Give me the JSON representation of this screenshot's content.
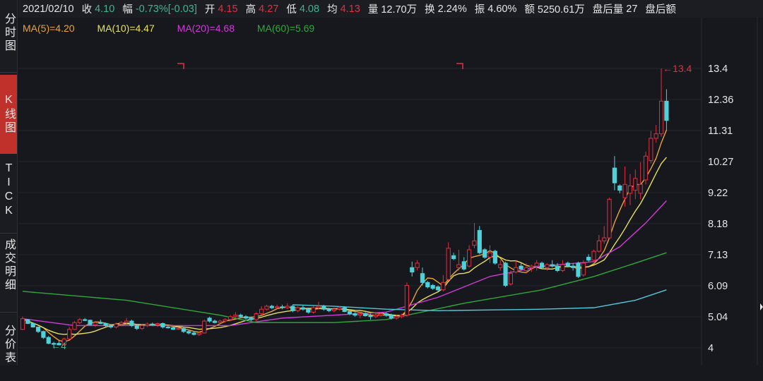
{
  "sidebar": {
    "items": [
      {
        "label": "分时图",
        "active": false
      },
      {
        "label": "K线图",
        "active": true
      },
      {
        "label": "TICK",
        "active": false
      },
      {
        "label": "成交明细",
        "active": false
      },
      {
        "label": "分价表",
        "active": false
      }
    ]
  },
  "header": {
    "date": "2021/02/10",
    "close_label": "收",
    "close": "4.10",
    "change_label": "幅",
    "change": "-0.73%[-0.03]",
    "open_label": "开",
    "open": "4.15",
    "high_label": "高",
    "high": "4.27",
    "low_label": "低",
    "low": "4.08",
    "avg_label": "均",
    "avg": "4.13",
    "volume_label": "量",
    "volume": "12.70万",
    "turnover_label": "换",
    "turnover": "2.24%",
    "amplitude_label": "振",
    "amplitude": "4.60%",
    "amount_label": "额",
    "amount": "5250.61万",
    "after_volume_label": "盘后量",
    "after_volume": "27",
    "after_amount_label": "盘后额"
  },
  "ma_legend": [
    {
      "label": "MA(5)=4.20",
      "color": "#e8a33a"
    },
    {
      "label": "MA(10)=4.47",
      "color": "#e6e05a"
    },
    {
      "label": "MA(20)=4.68",
      "color": "#d13ad6"
    },
    {
      "label": "MA(60)=5.69",
      "color": "#2fa83a"
    }
  ],
  "colors": {
    "up": "#e2303f",
    "down": "#4fd1d9",
    "background": "#16181d",
    "ma120": "#4fc8d9"
  },
  "chart_data": {
    "type": "candlestick",
    "ylim": [
      4,
      13.4
    ],
    "yticks": [
      "13.4",
      "12.36",
      "11.31",
      "10.27",
      "9.22",
      "8.18",
      "7.13",
      "6.09",
      "5.04",
      "4"
    ],
    "grid": true,
    "max_marker": "13.4",
    "min_marker": "4",
    "ohlc": [
      [
        4.62,
        5.05,
        4.6,
        4.98
      ],
      [
        4.95,
        4.97,
        4.8,
        4.82
      ],
      [
        4.82,
        4.85,
        4.68,
        4.7
      ],
      [
        4.7,
        4.72,
        4.5,
        4.55
      ],
      [
        4.55,
        4.58,
        4.3,
        4.35
      ],
      [
        4.35,
        4.4,
        4.12,
        4.15
      ],
      [
        4.15,
        4.2,
        4.0,
        4.12
      ],
      [
        4.15,
        4.27,
        4.08,
        4.1
      ],
      [
        4.1,
        4.35,
        4.1,
        4.3
      ],
      [
        4.3,
        4.7,
        4.28,
        4.62
      ],
      [
        4.62,
        4.9,
        4.6,
        4.85
      ],
      [
        4.85,
        5.0,
        4.8,
        4.95
      ],
      [
        4.95,
        5.0,
        4.9,
        4.93
      ],
      [
        4.93,
        4.95,
        4.75,
        4.78
      ],
      [
        4.78,
        4.9,
        4.7,
        4.85
      ],
      [
        4.85,
        4.95,
        4.8,
        4.82
      ],
      [
        4.82,
        4.85,
        4.7,
        4.75
      ],
      [
        4.75,
        4.8,
        4.65,
        4.7
      ],
      [
        4.7,
        4.85,
        4.65,
        4.8
      ],
      [
        4.8,
        4.9,
        4.75,
        4.85
      ],
      [
        4.85,
        5.0,
        4.8,
        4.9
      ],
      [
        4.9,
        4.95,
        4.7,
        4.75
      ],
      [
        4.75,
        4.8,
        4.6,
        4.65
      ],
      [
        4.65,
        4.8,
        4.6,
        4.75
      ],
      [
        4.75,
        4.85,
        4.7,
        4.8
      ],
      [
        4.8,
        4.85,
        4.75,
        4.78
      ],
      [
        4.78,
        4.85,
        4.7,
        4.82
      ],
      [
        4.82,
        4.85,
        4.65,
        4.7
      ],
      [
        4.7,
        4.75,
        4.65,
        4.68
      ],
      [
        4.68,
        4.72,
        4.6,
        4.62
      ],
      [
        4.62,
        4.7,
        4.6,
        4.65
      ],
      [
        4.65,
        4.68,
        4.5,
        4.55
      ],
      [
        4.55,
        4.6,
        4.45,
        4.5
      ],
      [
        4.5,
        4.55,
        4.42,
        4.45
      ],
      [
        4.45,
        4.55,
        4.4,
        4.5
      ],
      [
        4.5,
        4.95,
        4.48,
        4.9
      ],
      [
        5.0,
        5.05,
        4.85,
        4.9
      ],
      [
        4.9,
        4.95,
        4.82,
        4.85
      ],
      [
        4.85,
        4.95,
        4.8,
        4.9
      ],
      [
        4.9,
        5.0,
        4.85,
        4.95
      ],
      [
        4.95,
        5.1,
        4.9,
        5.05
      ],
      [
        5.05,
        5.2,
        5.0,
        5.1
      ],
      [
        5.1,
        5.15,
        5.0,
        5.05
      ],
      [
        5.05,
        5.1,
        4.95,
        5.0
      ],
      [
        5.0,
        5.05,
        4.9,
        4.95
      ],
      [
        4.95,
        5.2,
        4.9,
        5.15
      ],
      [
        5.15,
        5.4,
        5.1,
        5.3
      ],
      [
        5.3,
        5.45,
        5.25,
        5.4
      ],
      [
        5.4,
        5.45,
        5.3,
        5.35
      ],
      [
        5.35,
        5.45,
        5.3,
        5.38
      ],
      [
        5.38,
        5.45,
        5.3,
        5.35
      ],
      [
        5.35,
        5.5,
        5.3,
        5.4
      ],
      [
        5.4,
        5.45,
        5.2,
        5.25
      ],
      [
        5.25,
        5.4,
        5.2,
        5.35
      ],
      [
        5.35,
        5.45,
        5.25,
        5.3
      ],
      [
        5.3,
        5.35,
        5.15,
        5.2
      ],
      [
        5.2,
        5.4,
        5.15,
        5.35
      ],
      [
        5.35,
        5.55,
        5.3,
        5.4
      ],
      [
        5.4,
        5.45,
        5.25,
        5.3
      ],
      [
        5.3,
        5.35,
        5.2,
        5.25
      ],
      [
        5.25,
        5.35,
        5.2,
        5.3
      ],
      [
        5.3,
        5.4,
        5.25,
        5.35
      ],
      [
        5.35,
        5.4,
        5.2,
        5.22
      ],
      [
        5.22,
        5.3,
        5.1,
        5.15
      ],
      [
        5.15,
        5.2,
        5.05,
        5.1
      ],
      [
        5.1,
        5.2,
        5.0,
        5.15
      ],
      [
        5.15,
        5.2,
        5.05,
        5.08
      ],
      [
        5.08,
        5.15,
        4.95,
        5.05
      ],
      [
        5.05,
        5.15,
        5.0,
        5.1
      ],
      [
        5.1,
        5.2,
        5.05,
        5.15
      ],
      [
        5.15,
        5.2,
        5.05,
        5.1
      ],
      [
        5.1,
        5.15,
        4.95,
        5.0
      ],
      [
        5.0,
        5.1,
        4.95,
        5.05
      ],
      [
        5.05,
        5.15,
        5.0,
        5.1
      ],
      [
        5.1,
        6.2,
        5.05,
        6.1
      ],
      [
        6.7,
        6.9,
        6.4,
        6.55
      ],
      [
        6.7,
        6.95,
        6.6,
        6.85
      ],
      [
        6.5,
        6.7,
        6.1,
        6.2
      ],
      [
        6.2,
        6.25,
        6.0,
        6.05
      ],
      [
        6.1,
        6.15,
        5.95,
        6.0
      ],
      [
        6.05,
        6.1,
        5.9,
        5.95
      ],
      [
        5.95,
        6.45,
        5.9,
        6.2
      ],
      [
        6.3,
        7.55,
        6.25,
        7.35
      ],
      [
        7.1,
        7.2,
        6.95,
        7.0
      ],
      [
        6.7,
        7.3,
        6.6,
        6.8
      ],
      [
        6.9,
        7.05,
        6.6,
        6.65
      ],
      [
        6.75,
        7.45,
        6.7,
        7.3
      ],
      [
        7.45,
        8.2,
        7.35,
        7.6
      ],
      [
        7.95,
        8.1,
        7.15,
        7.2
      ],
      [
        7.3,
        7.35,
        7.0,
        7.05
      ],
      [
        7.05,
        7.45,
        6.85,
        7.2
      ],
      [
        7.25,
        7.3,
        6.8,
        6.85
      ],
      [
        6.7,
        6.95,
        6.6,
        6.8
      ],
      [
        6.85,
        6.9,
        6.05,
        6.1
      ],
      [
        6.15,
        6.6,
        6.1,
        6.5
      ],
      [
        6.55,
        6.95,
        6.5,
        6.7
      ],
      [
        6.75,
        6.85,
        6.6,
        6.65
      ],
      [
        6.6,
        6.85,
        6.5,
        6.7
      ],
      [
        6.7,
        6.8,
        6.55,
        6.75
      ],
      [
        6.75,
        6.95,
        6.6,
        6.85
      ],
      [
        6.85,
        6.9,
        6.65,
        6.7
      ],
      [
        6.7,
        6.85,
        6.6,
        6.8
      ],
      [
        6.8,
        6.95,
        6.7,
        6.75
      ],
      [
        6.75,
        6.85,
        6.55,
        6.6
      ],
      [
        6.6,
        6.95,
        6.55,
        6.8
      ],
      [
        6.85,
        6.9,
        6.7,
        6.75
      ],
      [
        6.75,
        6.85,
        6.6,
        6.7
      ],
      [
        6.85,
        6.9,
        6.35,
        6.4
      ],
      [
        6.45,
        6.95,
        6.4,
        6.85
      ],
      [
        7.05,
        7.15,
        6.9,
        6.95
      ],
      [
        6.95,
        7.3,
        6.9,
        7.25
      ],
      [
        7.25,
        7.8,
        7.2,
        7.6
      ],
      [
        7.6,
        8.1,
        7.5,
        7.7
      ],
      [
        7.7,
        9.05,
        7.65,
        9.0
      ],
      [
        10.05,
        10.45,
        9.3,
        9.55
      ],
      [
        9.45,
        9.5,
        9.2,
        9.3
      ],
      [
        9.05,
        10.1,
        8.75,
        9.5
      ],
      [
        9.2,
        9.85,
        8.8,
        9.45
      ],
      [
        9.3,
        10.0,
        9.0,
        9.7
      ],
      [
        9.2,
        10.25,
        9.0,
        9.5
      ],
      [
        9.65,
        10.6,
        9.5,
        10.45
      ],
      [
        10.3,
        11.3,
        10.2,
        11.05
      ],
      [
        11.05,
        11.5,
        10.9,
        11.2
      ],
      [
        11.2,
        13.4,
        11.1,
        12.3
      ],
      [
        12.3,
        12.7,
        11.3,
        11.65
      ]
    ],
    "ma_lines": [
      {
        "name": "MA(5)",
        "period": 5,
        "color": "#e8a33a"
      },
      {
        "name": "MA(10)",
        "period": 10,
        "color": "#e6e05a"
      },
      {
        "name": "MA(20)",
        "color": "#d13ad6",
        "points": [
          [
            0,
            4.98
          ],
          [
            10,
            4.75
          ],
          [
            30,
            4.75
          ],
          [
            40,
            4.75
          ],
          [
            50,
            5.0
          ],
          [
            70,
            5.2
          ],
          [
            80,
            5.7
          ],
          [
            90,
            6.4
          ],
          [
            100,
            6.75
          ],
          [
            110,
            6.9
          ],
          [
            115,
            7.4
          ],
          [
            120,
            8.2
          ],
          [
            124,
            8.95
          ]
        ]
      },
      {
        "name": "MA(60)",
        "color": "#2fa83a",
        "points": [
          [
            0,
            5.9
          ],
          [
            20,
            5.6
          ],
          [
            38,
            5.1
          ],
          [
            45,
            4.85
          ],
          [
            60,
            4.85
          ],
          [
            70,
            4.95
          ],
          [
            85,
            5.5
          ],
          [
            100,
            5.95
          ],
          [
            110,
            6.4
          ],
          [
            118,
            6.85
          ],
          [
            124,
            7.2
          ]
        ]
      },
      {
        "color": "#4fc8d9",
        "points": [
          [
            52,
            5.45
          ],
          [
            60,
            5.4
          ],
          [
            70,
            5.3
          ],
          [
            80,
            5.25
          ],
          [
            100,
            5.3
          ],
          [
            110,
            5.35
          ],
          [
            118,
            5.6
          ],
          [
            124,
            5.95
          ]
        ]
      }
    ]
  }
}
